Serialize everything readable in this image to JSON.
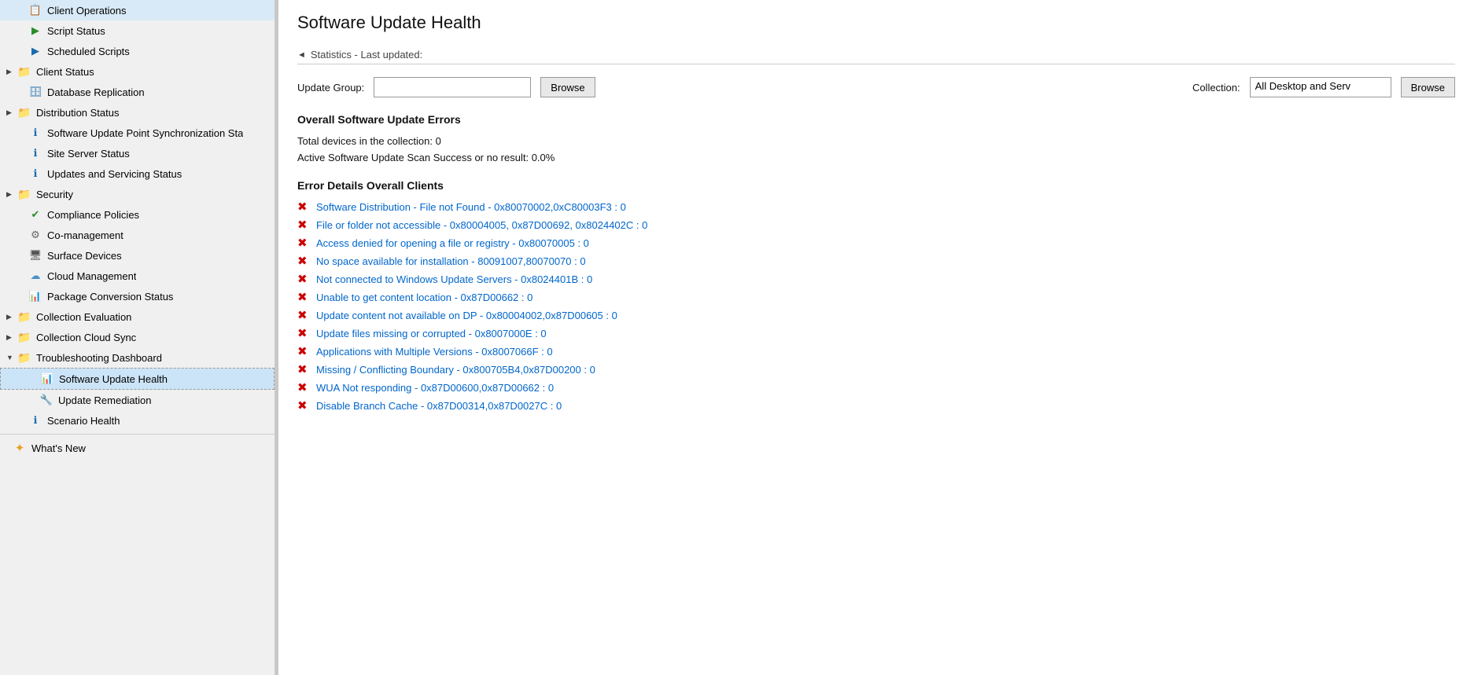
{
  "sidebar": {
    "items": [
      {
        "id": "client-operations",
        "label": "Client Operations",
        "icon": "📋",
        "iconType": "clipboard",
        "indent": 1,
        "expandable": false
      },
      {
        "id": "script-status",
        "label": "Script Status",
        "icon": "▶",
        "iconType": "green-arrow",
        "indent": 1,
        "expandable": false
      },
      {
        "id": "scheduled-scripts",
        "label": "Scheduled Scripts",
        "icon": "▶",
        "iconType": "green-arrow-blue",
        "indent": 1,
        "expandable": false
      },
      {
        "id": "client-status",
        "label": "Client Status",
        "icon": "📁",
        "iconType": "folder",
        "indent": 0,
        "expandable": true
      },
      {
        "id": "database-replication",
        "label": "Database Replication",
        "icon": "🔵",
        "iconType": "blue-db",
        "indent": 1,
        "expandable": false
      },
      {
        "id": "distribution-status",
        "label": "Distribution Status",
        "icon": "📁",
        "iconType": "folder",
        "indent": 0,
        "expandable": true
      },
      {
        "id": "software-update-point-sync",
        "label": "Software Update Point Synchronization Sta",
        "icon": "🔵",
        "iconType": "blue-info",
        "indent": 1,
        "expandable": false
      },
      {
        "id": "site-server-status",
        "label": "Site Server Status",
        "icon": "🔵",
        "iconType": "blue-info",
        "indent": 1,
        "expandable": false
      },
      {
        "id": "updates-servicing-status",
        "label": "Updates and Servicing Status",
        "icon": "🔵",
        "iconType": "blue-info",
        "indent": 1,
        "expandable": false
      },
      {
        "id": "security",
        "label": "Security",
        "icon": "📁",
        "iconType": "folder",
        "indent": 0,
        "expandable": true
      },
      {
        "id": "compliance-policies",
        "label": "Compliance Policies",
        "icon": "✅",
        "iconType": "check",
        "indent": 1,
        "expandable": false
      },
      {
        "id": "co-management",
        "label": "Co-management",
        "icon": "🔧",
        "iconType": "gear",
        "indent": 1,
        "expandable": false
      },
      {
        "id": "surface-devices",
        "label": "Surface Devices",
        "icon": "💻",
        "iconType": "monitor",
        "indent": 1,
        "expandable": false
      },
      {
        "id": "cloud-management",
        "label": "Cloud Management",
        "icon": "☁",
        "iconType": "cloud",
        "indent": 1,
        "expandable": false
      },
      {
        "id": "package-conversion-status",
        "label": "Package Conversion Status",
        "icon": "📊",
        "iconType": "chart",
        "indent": 1,
        "expandable": false
      },
      {
        "id": "collection-evaluation",
        "label": "Collection Evaluation",
        "icon": "📁",
        "iconType": "folder",
        "indent": 0,
        "expandable": true
      },
      {
        "id": "collection-cloud-sync",
        "label": "Collection Cloud Sync",
        "icon": "📁",
        "iconType": "folder",
        "indent": 0,
        "expandable": true
      },
      {
        "id": "troubleshooting-dashboard",
        "label": "Troubleshooting Dashboard",
        "icon": "📁",
        "iconType": "folder",
        "indent": 0,
        "expandable": true,
        "expanded": true
      },
      {
        "id": "software-update-health",
        "label": "Software Update Health",
        "icon": "📊",
        "iconType": "chart-blue",
        "indent": 2,
        "expandable": false,
        "selected": true
      },
      {
        "id": "update-remediation",
        "label": "Update Remediation",
        "icon": "🔧",
        "iconType": "wrench",
        "indent": 2,
        "expandable": false
      },
      {
        "id": "scenario-health",
        "label": "Scenario Health",
        "icon": "🔵",
        "iconType": "blue-scenario",
        "indent": 1,
        "expandable": false
      }
    ],
    "bottom_items": [
      {
        "id": "whats-new",
        "label": "What's New",
        "icon": "⭐",
        "iconType": "star"
      }
    ]
  },
  "main": {
    "page_title": "Software Update Health",
    "stats_section": {
      "label": "Statistics - Last updated:"
    },
    "filter": {
      "update_group_label": "Update Group:",
      "update_group_placeholder": "",
      "browse_btn": "Browse",
      "collection_label": "Collection:",
      "collection_value": "All Desktop and Serv",
      "collection_browse_btn": "Browse"
    },
    "overall_errors": {
      "title": "Overall Software Update Errors",
      "total_devices_label": "Total devices in the collection: 0",
      "scan_success_label": "Active Software Update Scan Success or no result: 0.0%"
    },
    "error_details": {
      "title": "Error Details Overall Clients",
      "errors": [
        {
          "text": "Software Distribution - File not Found - 0x80070002,0xC80003F3 : 0"
        },
        {
          "text": "File or folder not accessible - 0x80004005, 0x87D00692, 0x8024402C : 0"
        },
        {
          "text": "Access denied for opening a file or registry - 0x80070005 : 0"
        },
        {
          "text": "No space available for installation - 80091007,80070070 : 0"
        },
        {
          "text": "Not connected to Windows Update Servers - 0x8024401B  : 0"
        },
        {
          "text": "Unable to get content location - 0x87D00662  : 0"
        },
        {
          "text": "Update content not available on DP - 0x80004002,0x87D00605 : 0"
        },
        {
          "text": "Update files missing or corrupted - 0x8007000E : 0"
        },
        {
          "text": "Applications with Multiple Versions - 0x8007066F : 0"
        },
        {
          "text": "Missing / Conflicting Boundary - 0x800705B4,0x87D00200 : 0"
        },
        {
          "text": "WUA Not responding - 0x87D00600,0x87D00662 : 0"
        },
        {
          "text": "Disable Branch Cache - 0x87D00314,0x87D0027C : 0"
        }
      ]
    }
  }
}
